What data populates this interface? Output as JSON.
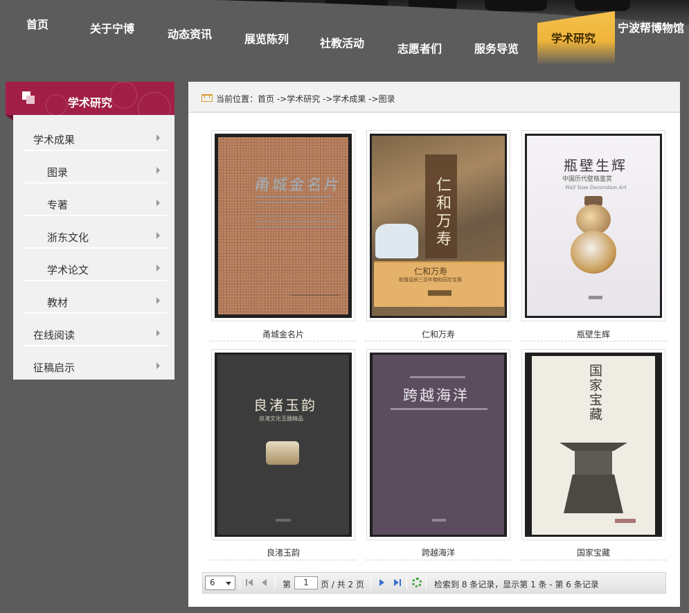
{
  "nav": {
    "items": [
      "首页",
      "关于宁博",
      "动态资讯",
      "展览陈列",
      "社教活动",
      "志愿者们",
      "服务导览",
      "学术研究",
      "宁波帮博物馆"
    ],
    "active": "学术研究"
  },
  "sidebar": {
    "title": "学术研究",
    "items": [
      {
        "label": "学术成果"
      },
      {
        "label": "图录"
      },
      {
        "label": "专著"
      },
      {
        "label": "浙东文化"
      },
      {
        "label": "学术论文"
      },
      {
        "label": "教材"
      },
      {
        "label": "在线阅读"
      },
      {
        "label": "征稿启示"
      }
    ]
  },
  "breadcrumb": "当前位置：首页 ->学术研究 ->学术成果 ->图录",
  "books": [
    {
      "title": "甬城金名片",
      "cover_title": "甬城金名片",
      "cover_color": "#b07a5a"
    },
    {
      "title": "仁和万寿",
      "cover_title": "仁和万寿",
      "cover_subtitle": "乾隆诞辰三百年御和园珍宝展",
      "cover_color": "#6a4f33"
    },
    {
      "title": "瓶壁生辉",
      "cover_title": "瓶壁生辉",
      "cover_subtitle": "中国历代壁瓶鉴赏",
      "cover_en": "Wall Vase Decoration Art",
      "cover_color": "#f1eef2"
    },
    {
      "title": "良渚玉韵",
      "cover_title": "良渚玉韵",
      "cover_subtitle": "良渚文化玉器精品",
      "cover_color": "#3a3a3a"
    },
    {
      "title": "跨越海洋",
      "cover_title": "跨越海洋",
      "cover_color": "#5b4d5e"
    },
    {
      "title": "国家宝藏",
      "cover_title": "国家宝藏",
      "cover_color": "#efece3"
    }
  ],
  "pager": {
    "page_size": "6",
    "page_prefix": "第",
    "current_page": "1",
    "page_suffix": "页 / 共 2 页",
    "summary": "检索到 8 条记录，显示第 1 条 - 第 6 条记录"
  }
}
